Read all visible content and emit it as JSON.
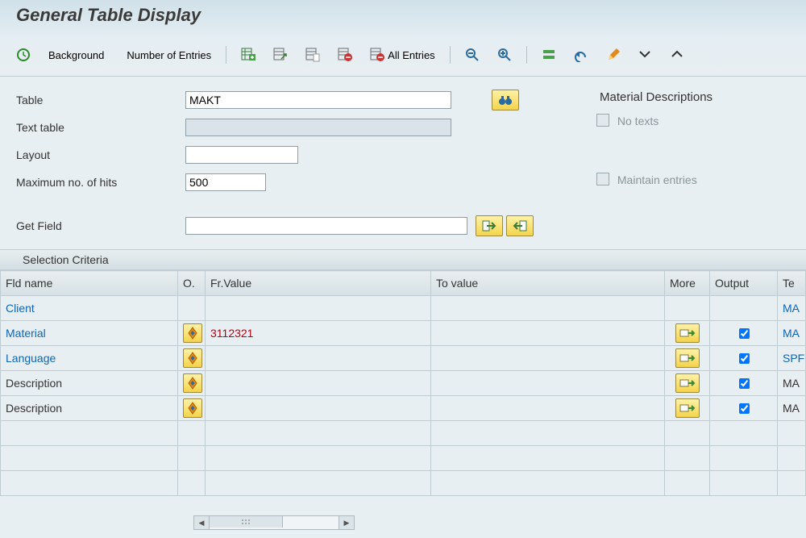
{
  "title": "General Table Display",
  "toolbar": {
    "background_label": "Background",
    "number_entries_label": "Number of Entries",
    "all_entries_label": "All Entries"
  },
  "form": {
    "table_label": "Table",
    "table_value": "MAKT",
    "text_table_label": "Text table",
    "text_table_value": "",
    "layout_label": "Layout",
    "layout_value": "",
    "max_hits_label": "Maximum no. of hits",
    "max_hits_value": "500",
    "get_field_label": "Get Field",
    "get_field_value": ""
  },
  "right": {
    "header": "Material Descriptions",
    "no_texts": "No texts",
    "maintain": "Maintain entries"
  },
  "panel": {
    "title": "Selection Criteria"
  },
  "grid": {
    "headers": {
      "fld": "Fld name",
      "op": "O.",
      "fr": "Fr.Value",
      "to": "To value",
      "more": "More",
      "output": "Output",
      "te": "Te"
    },
    "rows": [
      {
        "fld": "Client",
        "link": true,
        "op": false,
        "fr": "",
        "fr_red": false,
        "more": false,
        "output": false,
        "te": "MA",
        "te_link": true
      },
      {
        "fld": "Material",
        "link": true,
        "op": true,
        "fr": "3112321",
        "fr_red": true,
        "more": true,
        "output": true,
        "te": "MA",
        "te_link": true
      },
      {
        "fld": "Language",
        "link": true,
        "op": true,
        "fr": "",
        "fr_red": false,
        "more": true,
        "output": true,
        "te": "SPF",
        "te_link": true
      },
      {
        "fld": "Description",
        "link": false,
        "op": true,
        "fr": "",
        "fr_red": false,
        "more": true,
        "output": true,
        "te": "MA",
        "te_link": false
      },
      {
        "fld": "Description",
        "link": false,
        "op": true,
        "fr": "",
        "fr_red": false,
        "more": true,
        "output": true,
        "te": "MA",
        "te_link": false
      }
    ]
  }
}
